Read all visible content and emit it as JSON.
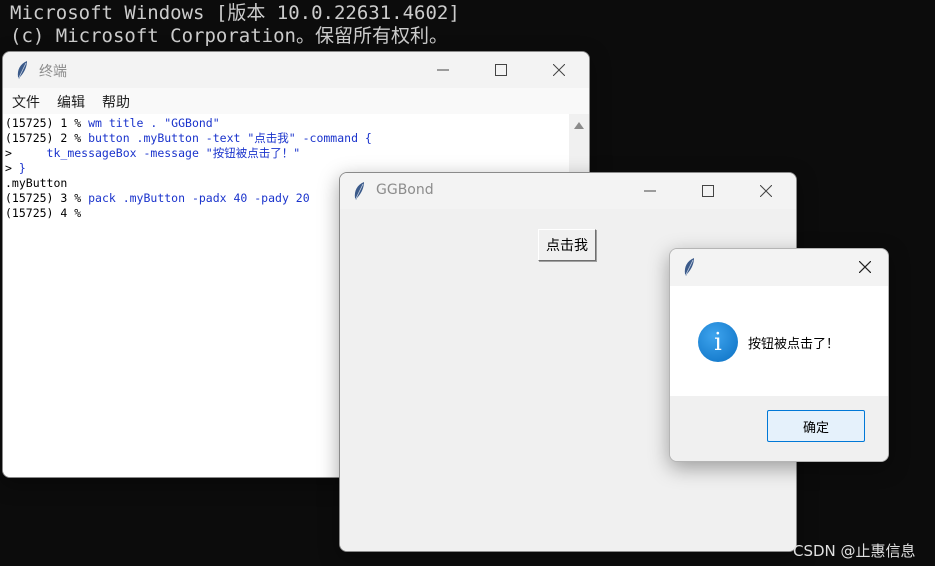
{
  "console": {
    "line1": "Microsoft Windows [版本 10.0.22631.4602]",
    "line2": "(c) Microsoft Corporation。保留所有权利。"
  },
  "terminal_window": {
    "title": "终端",
    "menu": [
      "文件",
      "编辑",
      "帮助"
    ],
    "lines": [
      {
        "prompt": "(15725) 1 % ",
        "cmd": "wm title . \"GGBond\""
      },
      {
        "prompt": "(15725) 2 % ",
        "cmd": "button .myButton -text \"点击我\" -command {"
      },
      {
        "prompt": ">     ",
        "cmd": "tk_messageBox -message \"按钮被点击了！\""
      },
      {
        "prompt": "> ",
        "cmd": "}"
      },
      {
        "prompt": ".myButton",
        "cmd": ""
      },
      {
        "prompt": "(15725) 3 % ",
        "cmd": "pack .myButton -padx 40 -pady 20"
      },
      {
        "prompt": "(15725) 4 % ",
        "cmd": ""
      }
    ]
  },
  "ggbond_window": {
    "title": "GGBond",
    "button_label": "点击我"
  },
  "message_box": {
    "icon": "info-icon",
    "icon_glyph": "i",
    "message": "按钮被点击了！",
    "ok_label": "确定"
  },
  "watermark": "CSDN @止惠信息",
  "colors": {
    "console_bg": "#0c0c0c",
    "console_text": "#cccccc",
    "command_blue": "#1a33cc",
    "info_blue": "#0a6fc2",
    "accent": "#0078d7"
  }
}
